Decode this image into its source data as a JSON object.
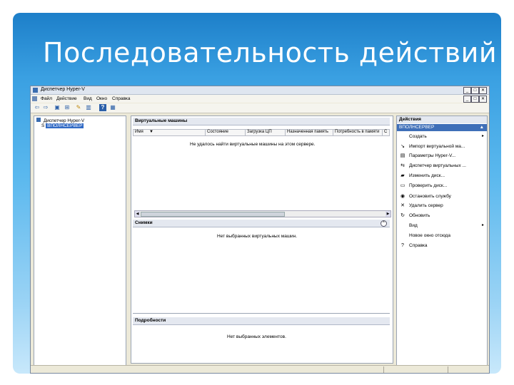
{
  "slide": {
    "title": "Последовательность действий"
  },
  "window": {
    "title": "Диспетчер Hyper-V",
    "controls": {
      "minimize": "_",
      "restore": "□",
      "close": "✕"
    },
    "subwindow_controls": {
      "minimize": "_",
      "restore": "□",
      "close": "✕"
    }
  },
  "menu": {
    "items": [
      "Файл",
      "Действие",
      "Вид",
      "Окно",
      "Справка"
    ]
  },
  "tree": {
    "root": "Диспетчер Hyper-V",
    "server": "S ████████",
    "server_visible": "S",
    "server_selected": "ВПОЛНСЕРВЕР"
  },
  "vms": {
    "header": "Виртуальные машины",
    "columns": [
      "Имя",
      "Состояние",
      "Загрузка ЦП",
      "Назначенная память",
      "Потребность в памяти",
      "С"
    ],
    "empty_text": "Не удалось найти виртуальные машины на этом сервере."
  },
  "snapshots": {
    "header": "Снимки",
    "empty_text": "Нет выбранных виртуальных машин."
  },
  "details": {
    "header": "Подробности",
    "empty_text": "Нет выбранных элементов."
  },
  "actions": {
    "header": "Действия",
    "server_label": "ВПОЛНСЕРВЕР",
    "items": [
      {
        "label": "Создать",
        "icon": "new-icon",
        "glyph": "",
        "submenu": true
      },
      {
        "label": "Импорт виртуальной ма...",
        "icon": "import-icon",
        "glyph": "↘",
        "submenu": false
      },
      {
        "label": "Параметры Hyper-V...",
        "icon": "settings-icon",
        "glyph": "▤",
        "submenu": false
      },
      {
        "label": "Диспетчер виртуальных ...",
        "icon": "switch-manager-icon",
        "glyph": "⇆",
        "submenu": false
      },
      {
        "label": "Изменить диск...",
        "icon": "edit-disk-icon",
        "glyph": "▰",
        "submenu": false
      },
      {
        "label": "Проверить диск...",
        "icon": "inspect-disk-icon",
        "glyph": "▭",
        "submenu": false
      },
      {
        "label": "Остановить службу",
        "icon": "stop-service-icon",
        "glyph": "◉",
        "submenu": false
      },
      {
        "label": "Удалить сервер",
        "icon": "remove-server-icon",
        "glyph": "✕",
        "submenu": false
      },
      {
        "label": "Обновить",
        "icon": "refresh-icon",
        "glyph": "↻",
        "submenu": false
      },
      {
        "label": "Вид",
        "icon": "",
        "glyph": "",
        "submenu": true
      },
      {
        "label": "Новое окно отсюда",
        "icon": "",
        "glyph": "",
        "submenu": false
      },
      {
        "label": "Справка",
        "icon": "help-icon",
        "glyph": "?",
        "submenu": false
      }
    ]
  },
  "colors": {
    "slide_top": "#1d7fc9",
    "slide_bottom": "#c8e8fb",
    "selection": "#316ac5",
    "action_header": "#3f6fb8"
  }
}
